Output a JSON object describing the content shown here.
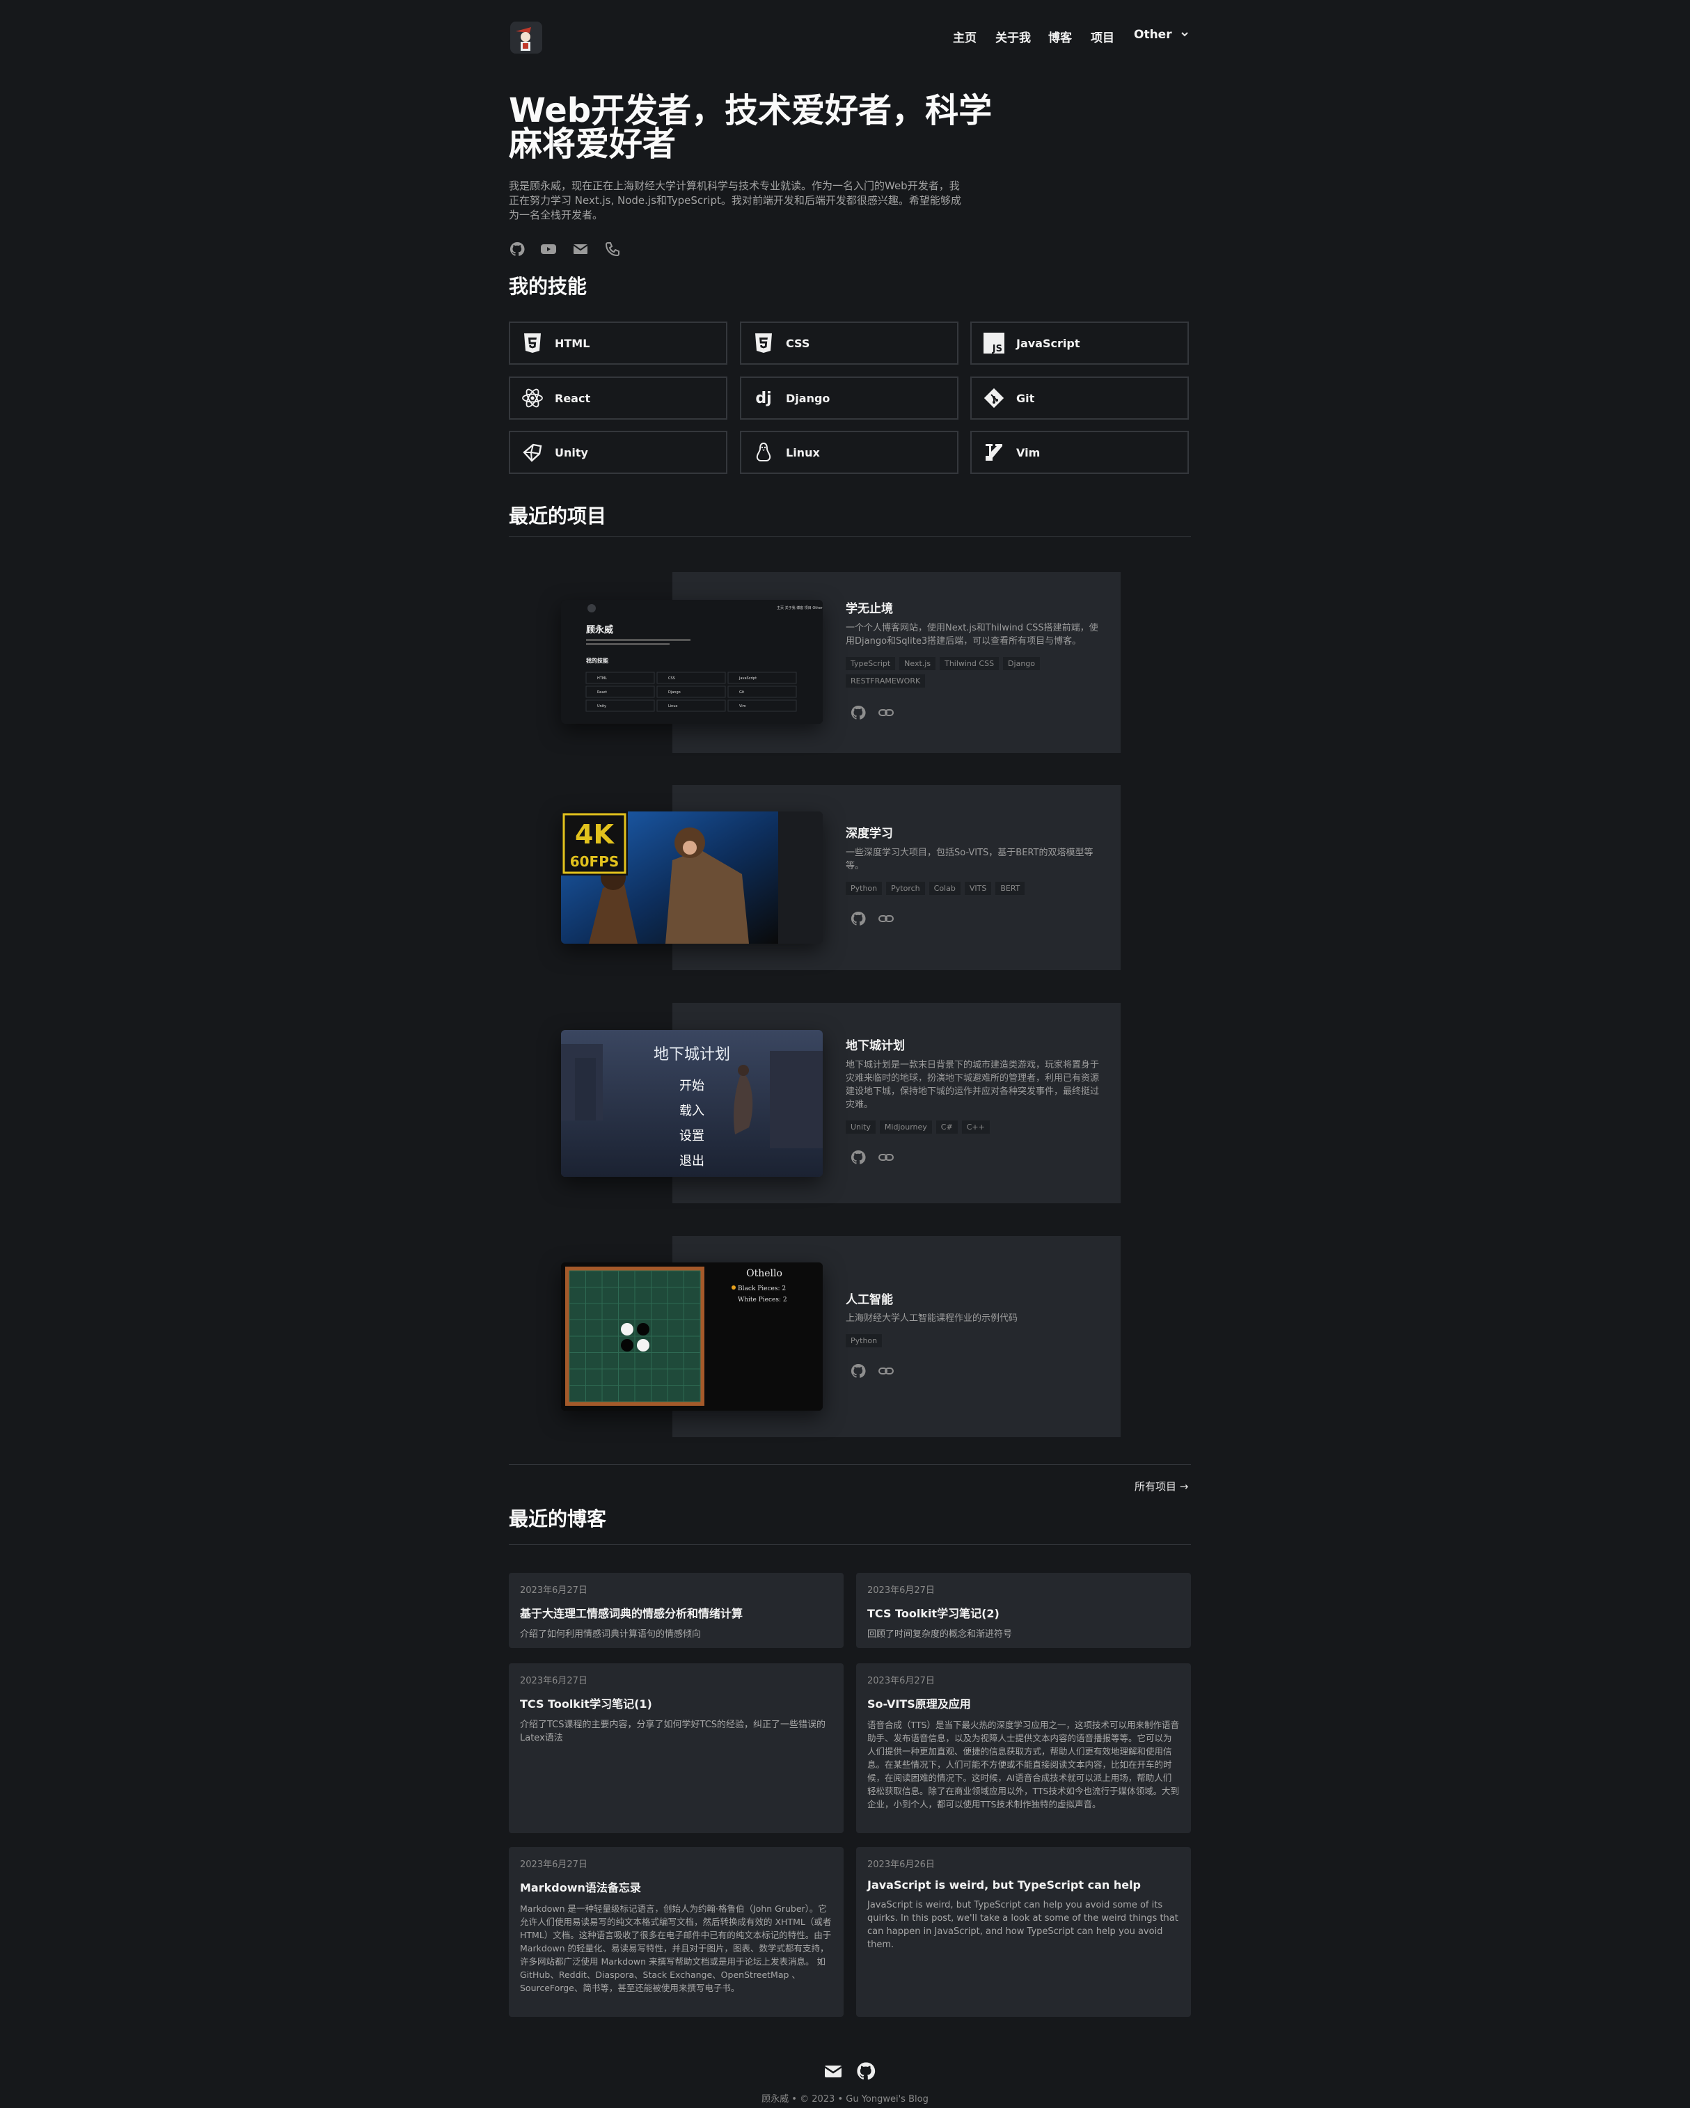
{
  "nav": {
    "items": [
      "主页",
      "关于我",
      "博客",
      "项目",
      "Other"
    ]
  },
  "hero": {
    "title": "Web开发者，技术爱好者，科学麻将爱好者",
    "description": "我是顾永威，现在正在上海财经大学计算机科学与技术专业就读。作为一名入门的Web开发者，我正在努力学习 Next.js, Node.js和TypeScript。我对前端开发和后端开发都很感兴趣。希望能够成为一名全栈开发者。",
    "social_icons": [
      "github-icon",
      "youtube-icon",
      "mail-icon",
      "phone-icon"
    ]
  },
  "skills": {
    "heading": "我的技能",
    "items": [
      {
        "label": "HTML",
        "icon": "html5-icon"
      },
      {
        "label": "CSS",
        "icon": "css3-icon"
      },
      {
        "label": "JavaScript",
        "icon": "javascript-icon"
      },
      {
        "label": "React",
        "icon": "react-icon"
      },
      {
        "label": "Django",
        "icon": "django-icon"
      },
      {
        "label": "Git",
        "icon": "git-icon"
      },
      {
        "label": "Unity",
        "icon": "unity-icon"
      },
      {
        "label": "Linux",
        "icon": "linux-icon"
      },
      {
        "label": "Vim",
        "icon": "vim-icon"
      }
    ]
  },
  "projects": {
    "heading": "最近的项目",
    "all_link": "所有项目 →",
    "items": [
      {
        "title": "学无止境",
        "description": "一个个人博客网站，使用Next.js和Thilwind CSS搭建前端，使用Django和Sqlite3搭建后端，可以查看所有项目与博客。",
        "tags": [
          "TypeScript",
          "Next.js",
          "Thilwind CSS",
          "Django",
          "RESTFRAMEWORK"
        ],
        "thumb": {
          "site_name": "顾永威",
          "section": "我的技能",
          "nav": [
            "主页",
            "关于我",
            "博客",
            "项目",
            "Other"
          ],
          "skills": [
            "HTML",
            "CSS",
            "JavaScript",
            "React",
            "Django",
            "Git",
            "Unity",
            "Linux",
            "Vim"
          ]
        }
      },
      {
        "title": "深度学习",
        "description": "一些深度学习大项目，包括So-VITS，基于BERT的双塔模型等等。",
        "tags": [
          "Python",
          "Pytorch",
          "Colab",
          "VITS",
          "BERT"
        ],
        "thumb": {
          "badge_top": "4K",
          "badge_bottom": "60FPS"
        }
      },
      {
        "title": "地下城计划",
        "description": "地下城计划是一款末日背景下的城市建造类游戏，玩家将置身于灾难来临时的地球，扮演地下城避难所的管理者，利用已有资源建设地下城，保持地下城的运作并应对各种突发事件，最终挺过灾难。",
        "tags": [
          "Unity",
          "Midjourney",
          "C#",
          "C++"
        ],
        "thumb": {
          "title": "地下城计划",
          "menu": [
            "开始",
            "载入",
            "设置",
            "退出"
          ]
        }
      },
      {
        "title": "人工智能",
        "description": "上海财经大学人工智能课程作业的示例代码",
        "tags": [
          "Python"
        ],
        "thumb": {
          "game": "Othello",
          "black": "Black Pieces: 2",
          "white": "White Pieces: 2"
        }
      }
    ]
  },
  "blogs": {
    "heading": "最近的博客",
    "items": [
      {
        "date": "2023年6月27日",
        "title": "基于大连理工情感词典的情感分析和情绪计算",
        "description": "介绍了如何利用情感词典计算语句的情感倾向"
      },
      {
        "date": "2023年6月27日",
        "title": "TCS Toolkit学习笔记(2)",
        "description": "回顾了时间复杂度的概念和渐进符号"
      },
      {
        "date": "2023年6月27日",
        "title": "TCS Toolkit学习笔记(1)",
        "description": "介绍了TCS课程的主要内容，分享了如何学好TCS的经验，纠正了一些错误的Latex语法"
      },
      {
        "date": "2023年6月27日",
        "title": "So-VITS原理及应用",
        "description": "语音合成（TTS）是当下最火热的深度学习应用之一，这项技术可以用来制作语音助手、发布语音信息，以及为视障人士提供文本内容的语音播报等等。它可以为人们提供一种更加直观、便捷的信息获取方式，帮助人们更有效地理解和使用信息。在某些情况下，人们可能不方便或不能直接阅读文本内容，比如在开车的时候，在阅读困难的情况下。这时候，AI语音合成技术就可以派上用场，帮助人们轻松获取信息。除了在商业领域应用以外，TTS技术如今也流行于媒体领域。大到企业，小到个人，都可以使用TTS技术制作独特的虚拟声音。"
      },
      {
        "date": "2023年6月27日",
        "title": "Markdown语法备忘录",
        "description": "Markdown 是一种轻量级标记语言，创始人为约翰·格鲁伯（John Gruber）。它允许人们使用易读易写的纯文本格式编写文档，然后转换成有效的 XHTML（或者HTML）文档。这种语言吸收了很多在电子邮件中已有的纯文本标记的特性。由于 Markdown 的轻量化、易读易写特性，并且对于图片，图表、数学式都有支持，许多网站都广泛使用 Markdown 来撰写帮助文档或是用于论坛上发表消息。 如 GitHub、Reddit、Diaspora、Stack Exchange、OpenStreetMap 、SourceForge、简书等，甚至还能被使用来撰写电子书。"
      },
      {
        "date": "2023年6月26日",
        "title": "JavaScript is weird, but TypeScript can help",
        "description": "JavaScript is weird, but TypeScript can help you avoid some of its quirks. In this post, we'll take a look at some of the weird things that can happen in JavaScript, and how TypeScript can help you avoid them."
      }
    ]
  },
  "footer": {
    "text": "顾永威 • © 2023 • Gu Yongwei's Blog",
    "icons": [
      "mail-icon",
      "github-icon"
    ]
  },
  "colors": {
    "background": "#16181b",
    "card": "#25282d",
    "border": "#34373c",
    "text": "#f2f2f2",
    "muted": "#9c9c9c"
  }
}
